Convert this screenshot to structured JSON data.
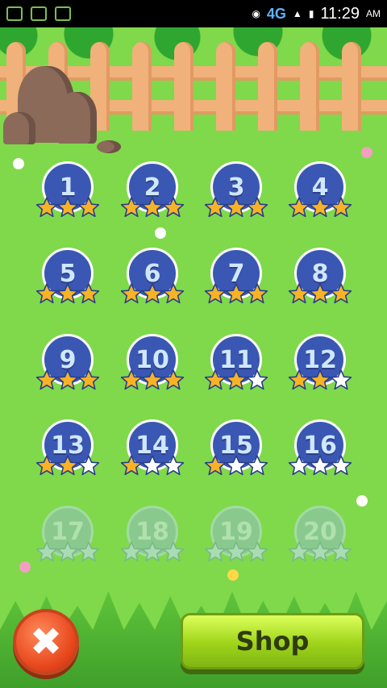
{
  "status_bar": {
    "network": "4G",
    "time": "11:29",
    "ampm": "AM"
  },
  "levels": [
    {
      "number": "1",
      "stars": 3,
      "locked": false
    },
    {
      "number": "2",
      "stars": 3,
      "locked": false
    },
    {
      "number": "3",
      "stars": 3,
      "locked": false
    },
    {
      "number": "4",
      "stars": 3,
      "locked": false
    },
    {
      "number": "5",
      "stars": 3,
      "locked": false
    },
    {
      "number": "6",
      "stars": 3,
      "locked": false
    },
    {
      "number": "7",
      "stars": 3,
      "locked": false
    },
    {
      "number": "8",
      "stars": 3,
      "locked": false
    },
    {
      "number": "9",
      "stars": 3,
      "locked": false
    },
    {
      "number": "10",
      "stars": 3,
      "locked": false
    },
    {
      "number": "11",
      "stars": 2,
      "locked": false
    },
    {
      "number": "12",
      "stars": 2,
      "locked": false
    },
    {
      "number": "13",
      "stars": 2,
      "locked": false
    },
    {
      "number": "14",
      "stars": 1,
      "locked": false
    },
    {
      "number": "15",
      "stars": 1,
      "locked": false
    },
    {
      "number": "16",
      "stars": 0,
      "locked": false
    },
    {
      "number": "17",
      "stars": 0,
      "locked": true
    },
    {
      "number": "18",
      "stars": 0,
      "locked": true
    },
    {
      "number": "19",
      "stars": 0,
      "locked": true
    },
    {
      "number": "20",
      "stars": 0,
      "locked": true
    }
  ],
  "buttons": {
    "close_icon": "close-x-icon",
    "shop_label": "Shop"
  },
  "colors": {
    "grass": "#7fd94a",
    "level_badge": "#3a57b3",
    "star_filled": "#f7b324",
    "star_empty": "#ffffff",
    "close_button": "#e7461c",
    "shop_button": "#9ed419"
  }
}
